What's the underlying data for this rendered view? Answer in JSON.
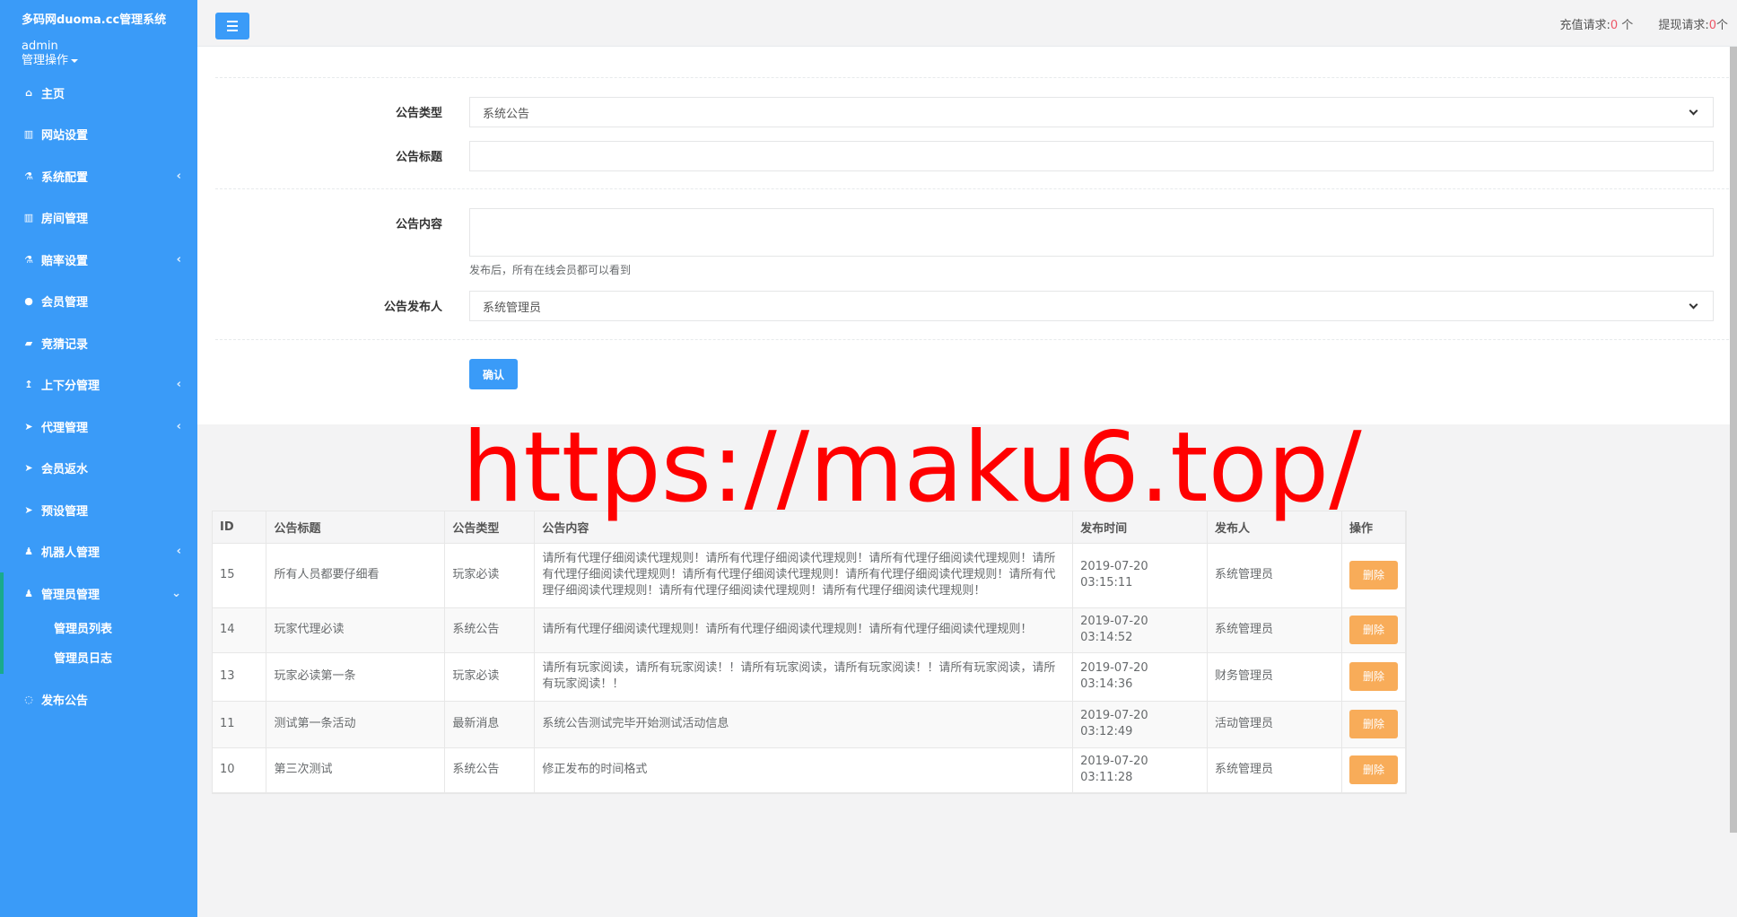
{
  "sidebar": {
    "brand": "多码网duoma.cc管理系统",
    "user": "admin",
    "ops": "管理操作",
    "items": [
      {
        "label": "主页",
        "icon": "home-icon",
        "glyph": "⌂",
        "chev": ""
      },
      {
        "label": "网站设置",
        "icon": "columns-icon",
        "glyph": "▥",
        "chev": ""
      },
      {
        "label": "系统配置",
        "icon": "flask-icon",
        "glyph": "⚗",
        "chev": "‹"
      },
      {
        "label": "房间管理",
        "icon": "columns-icon",
        "glyph": "▥",
        "chev": ""
      },
      {
        "label": "赔率设置",
        "icon": "flask-icon",
        "glyph": "⚗",
        "chev": "‹"
      },
      {
        "label": "会员管理",
        "icon": "user-icon",
        "glyph": "●",
        "chev": ""
      },
      {
        "label": "竞猜记录",
        "icon": "car-icon",
        "glyph": "▰",
        "chev": ""
      },
      {
        "label": "上下分管理",
        "icon": "level-up-icon",
        "glyph": "↥",
        "chev": "‹"
      },
      {
        "label": "代理管理",
        "icon": "paper-plane-icon",
        "glyph": "➤",
        "chev": "‹"
      },
      {
        "label": "会员返水",
        "icon": "paper-plane-icon",
        "glyph": "➤",
        "chev": ""
      },
      {
        "label": "预设管理",
        "icon": "paper-plane-icon",
        "glyph": "➤",
        "chev": ""
      },
      {
        "label": "机器人管理",
        "icon": "male-icon",
        "glyph": "♟",
        "chev": "‹"
      },
      {
        "label": "管理员管理",
        "icon": "male-icon",
        "glyph": "♟",
        "chev": "⌄"
      }
    ],
    "sub_items": [
      "管理员列表",
      "管理员日志"
    ],
    "last_item": {
      "label": "发布公告",
      "icon": "comment-icon",
      "glyph": "◌"
    }
  },
  "topbar": {
    "recharge_label": "充值请求:",
    "recharge_count": "0",
    "recharge_unit": " 个",
    "withdraw_label": "提现请求:",
    "withdraw_count": "0",
    "withdraw_unit": "个"
  },
  "form": {
    "type_label": "公告类型",
    "type_value": "系统公告",
    "title_label": "公告标题",
    "title_value": "",
    "content_label": "公告内容",
    "content_value": "",
    "content_help": "发布后，所有在线会员都可以看到",
    "publisher_label": "公告发布人",
    "publisher_value": "系统管理员",
    "confirm": "确认"
  },
  "table": {
    "headers": [
      "ID",
      "公告标题",
      "公告类型",
      "公告内容",
      "发布时间",
      "发布人",
      "操作"
    ],
    "rows": [
      {
        "id": "15",
        "title": "所有人员都要仔细看",
        "type": "玩家必读",
        "content": "请所有代理仔细阅读代理规则！请所有代理仔细阅读代理规则！请所有代理仔细阅读代理规则！请所有代理仔细阅读代理规则！请所有代理仔细阅读代理规则！请所有代理仔细阅读代理规则！请所有代理仔细阅读代理规则！请所有代理仔细阅读代理规则！请所有代理仔细阅读代理规则！",
        "time": "2019-07-20 03:15:11",
        "publisher": "系统管理员",
        "action": "删除"
      },
      {
        "id": "14",
        "title": "玩家代理必读",
        "type": "系统公告",
        "content": "请所有代理仔细阅读代理规则！请所有代理仔细阅读代理规则！请所有代理仔细阅读代理规则！",
        "time": "2019-07-20 03:14:52",
        "publisher": "系统管理员",
        "action": "删除"
      },
      {
        "id": "13",
        "title": "玩家必读第一条",
        "type": "玩家必读",
        "content": "请所有玩家阅读，请所有玩家阅读！！请所有玩家阅读，请所有玩家阅读！！请所有玩家阅读，请所有玩家阅读！！",
        "time": "2019-07-20 03:14:36",
        "publisher": "财务管理员",
        "action": "删除"
      },
      {
        "id": "11",
        "title": "测试第一条活动",
        "type": "最新消息",
        "content": "系统公告测试完毕开始测试活动信息",
        "time": "2019-07-20 03:12:49",
        "publisher": "活动管理员",
        "action": "删除"
      },
      {
        "id": "10",
        "title": "第三次测试",
        "type": "系统公告",
        "content": "修正发布的时间格式",
        "time": "2019-07-20 03:11:28",
        "publisher": "系统管理员",
        "action": "删除"
      }
    ]
  },
  "watermark": "https://maku6.top/",
  "colors": {
    "sidebar": "#3a9bf8",
    "accent_green": "#19aa8d",
    "delete": "#f8ac59",
    "watermark": "#ff0000",
    "count": "#ed5565"
  }
}
